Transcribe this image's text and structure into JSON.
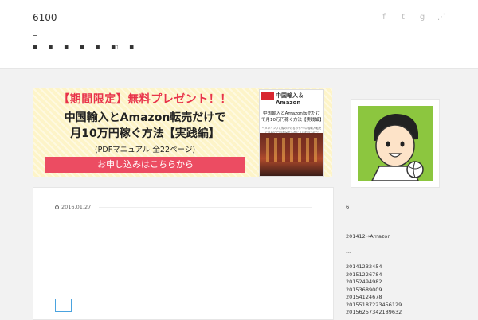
{
  "header": {
    "site_title": "6100",
    "social_icons": [
      "facebook-icon",
      "twitter-icon",
      "google-plus-icon",
      "rss-icon"
    ],
    "social_glyphs": [
      "f",
      "t",
      "g",
      "⋰"
    ],
    "nav": [
      "■",
      "■",
      "■",
      "■",
      "■",
      "■▯",
      "■"
    ]
  },
  "banner": {
    "line1": "【期間限定】無料プレゼント！！",
    "line2": "中国輸入とAmazon転売だけで",
    "line3": "月10万円稼ぐ方法【実践編】",
    "line4": "(PDFマニュアル 全22ページ)",
    "cta": "お申し込みはこちらから",
    "book_tag": "中国輸入＆Amazon",
    "book_title": "中国輸入とAmazon転売だけで月10万円稼ぐ方法【実践編】",
    "book_sub": "〜メタインプに縦のかけるのも〜 中国輸入転売で月10万円の利益を生みだすためのもの〜"
  },
  "post": {
    "date": "2016.01.27"
  },
  "sidebar": {
    "count": "6",
    "link": "201412→Amazon",
    "more": "...",
    "items": [
      "20141232454",
      "20151226784",
      "20152494982",
      "20153689009",
      "20154124678",
      "20155187223456129",
      "20156257342189632"
    ]
  },
  "colors": {
    "accent_red": "#e8334a",
    "cta_bg": "#ec4c62",
    "banner_bg": "#fdf4c8",
    "avatar_green": "#8cc63f"
  }
}
